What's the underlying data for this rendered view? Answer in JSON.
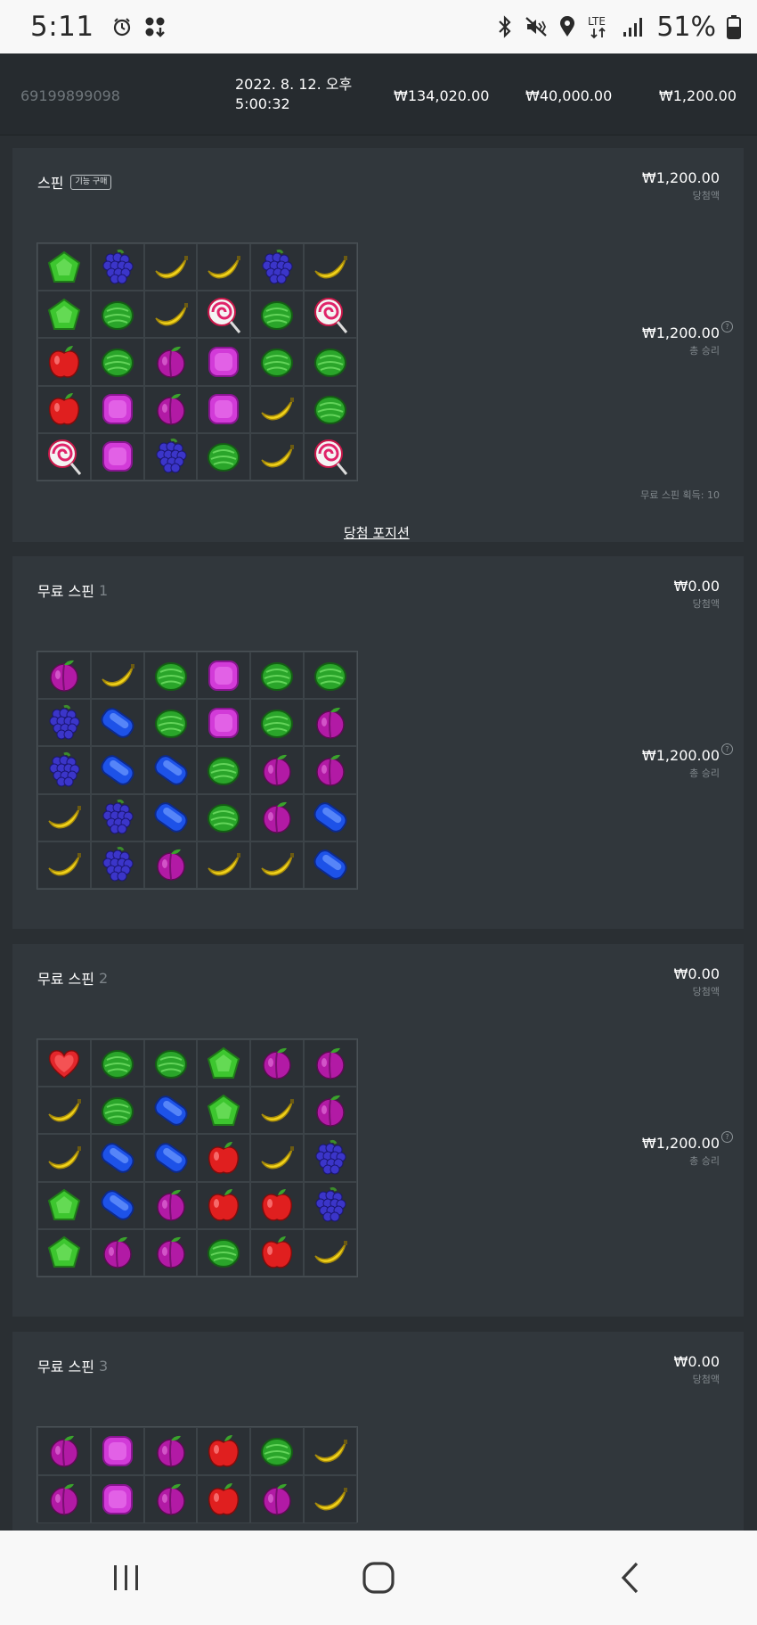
{
  "status_bar": {
    "time": "5:11",
    "battery_text": "51%",
    "icons": [
      "alarm-icon",
      "app-download-icon",
      "bluetooth-icon",
      "mute-icon",
      "location-icon",
      "lte-icon",
      "signal-icon",
      "battery-icon"
    ]
  },
  "summary": {
    "round_id": "69199899098",
    "date": "2022. 8. 12. 오후 5:00:32",
    "bet": "₩134,020.00",
    "balance": "₩40,000.00",
    "win": "₩1,200.00"
  },
  "panels": [
    {
      "title": "스핀",
      "badge": "기능 구매",
      "num": "",
      "win_amount": "₩1,200.00",
      "win_label": "당첨액",
      "total_amount": "₩1,200.00",
      "total_label": "총 승리",
      "free_spins_note": "무료 스핀 획득: 10",
      "win_positions_link": "당첨 포지션",
      "grid": [
        [
          "green",
          "grape",
          "banana",
          "banana",
          "grape",
          "banana"
        ],
        [
          "green",
          "melon",
          "banana",
          "lolli",
          "melon",
          "lolli"
        ],
        [
          "apple",
          "melon",
          "plum",
          "pink",
          "melon",
          "melon"
        ],
        [
          "apple",
          "pink",
          "plum",
          "pink",
          "banana",
          "melon"
        ],
        [
          "lolli",
          "pink",
          "grape",
          "melon",
          "banana",
          "lolli"
        ]
      ]
    },
    {
      "title": "무료 스핀",
      "num": "1",
      "win_amount": "₩0.00",
      "win_label": "당첨액",
      "total_amount": "₩1,200.00",
      "total_label": "총 승리",
      "grid": [
        [
          "plum",
          "banana",
          "melon",
          "pink",
          "melon",
          "melon"
        ],
        [
          "grape",
          "blue",
          "melon",
          "pink",
          "melon",
          "plum"
        ],
        [
          "grape",
          "blue",
          "blue",
          "melon",
          "plum",
          "plum"
        ],
        [
          "banana",
          "grape",
          "blue",
          "melon",
          "plum",
          "blue"
        ],
        [
          "banana",
          "grape",
          "plum",
          "banana",
          "banana",
          "blue"
        ]
      ]
    },
    {
      "title": "무료 스핀",
      "num": "2",
      "win_amount": "₩0.00",
      "win_label": "당첨액",
      "total_amount": "₩1,200.00",
      "total_label": "총 승리",
      "grid": [
        [
          "heart",
          "melon",
          "melon",
          "green",
          "plum",
          "plum"
        ],
        [
          "banana",
          "melon",
          "blue",
          "green",
          "banana",
          "plum"
        ],
        [
          "banana",
          "blue",
          "blue",
          "apple",
          "banana",
          "grape"
        ],
        [
          "green",
          "blue",
          "plum",
          "apple",
          "apple",
          "grape"
        ],
        [
          "green",
          "plum",
          "plum",
          "melon",
          "apple",
          "banana"
        ]
      ]
    },
    {
      "title": "무료 스핀",
      "num": "3",
      "win_amount": "₩0.00",
      "win_label": "당첨액",
      "grid": [
        [
          "plum",
          "pink",
          "plum",
          "apple",
          "melon",
          "banana"
        ],
        [
          "plum",
          "pink",
          "plum",
          "apple",
          "plum",
          "banana"
        ]
      ]
    }
  ],
  "symbol_colors": {
    "green": "#3dc62f",
    "grape": "#3b35c9",
    "banana": "#f1d21a",
    "lolli": "#f3f3f3",
    "melon": "#2aa52a",
    "apple": "#e01f1f",
    "plum": "#b21aa5",
    "pink": "#d23bd8",
    "blue": "#1d52e8",
    "heart": "#e3262b"
  }
}
